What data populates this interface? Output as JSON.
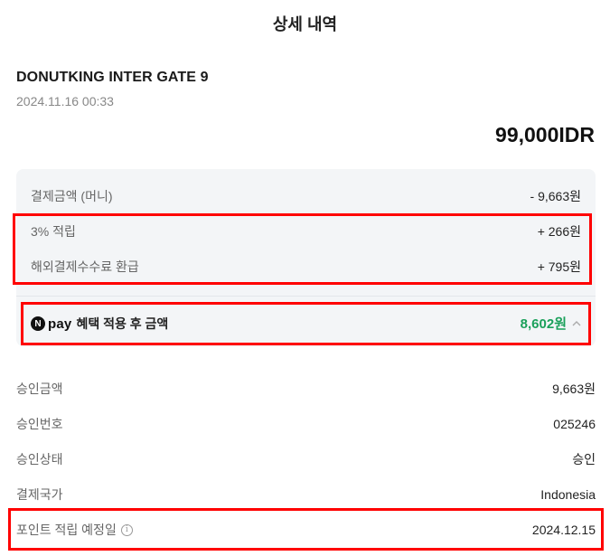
{
  "header": {
    "title": "상세 내역"
  },
  "merchant": {
    "name": "DONUTKING INTER GATE 9",
    "datetime": "2024.11.16 00:33"
  },
  "transaction": {
    "amount": "99,000IDR"
  },
  "summary": {
    "rows": [
      {
        "label": "결제금액 (머니)",
        "value": "- 9,663원"
      },
      {
        "label": "3% 적립",
        "value": "+ 266원"
      },
      {
        "label": "해외결제수수료 환급",
        "value": "+ 795원"
      }
    ],
    "benefit": {
      "badge_letter": "N",
      "badge_text": "pay",
      "label": "혜택 적용 후 금액",
      "value": "8,602원",
      "value_color": "#1aa05a"
    }
  },
  "details": {
    "rows": [
      {
        "label": "승인금액",
        "value": "9,663원"
      },
      {
        "label": "승인번호",
        "value": "025246"
      },
      {
        "label": "승인상태",
        "value": "승인"
      },
      {
        "label": "결제국가",
        "value": "Indonesia"
      },
      {
        "label": "포인트 적립 예정일",
        "value": "2024.12.15",
        "icon": "info-icon"
      }
    ]
  },
  "highlight_color": "#ff0000"
}
